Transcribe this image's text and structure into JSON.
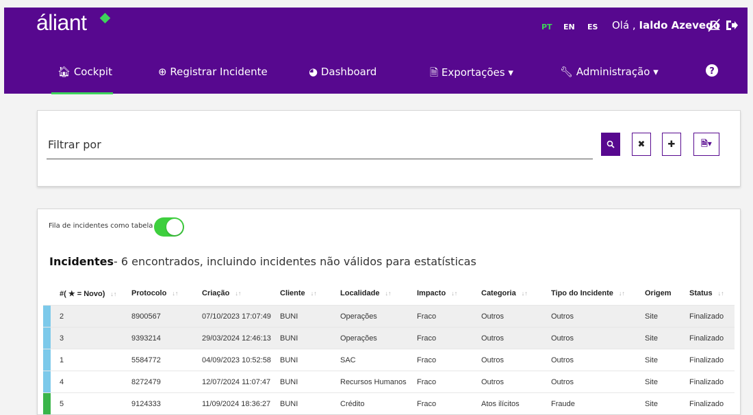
{
  "header": {
    "logo": "áliant",
    "languages": [
      {
        "code": "PT",
        "active": true
      },
      {
        "code": "EN",
        "active": false
      },
      {
        "code": "ES",
        "active": false
      }
    ],
    "greeting_prefix": "Olá ,",
    "user_name": "Ialdo Azevedo",
    "icons": [
      "notifications-off-icon",
      "logout-icon"
    ]
  },
  "nav": {
    "cockpit": "Cockpit",
    "registrar": "Registrar Incidente",
    "dashboard": "Dashboard",
    "exportacoes": "Exportações",
    "administracao": "Administração",
    "help_icon": "question-circle-icon"
  },
  "filter": {
    "label": "Filtrar por",
    "buttons": [
      "search-icon",
      "clear-icon",
      "add-icon",
      "export-file-icon"
    ]
  },
  "incidents": {
    "toggle_label": "Fila de incidentes como tabela",
    "toggle_on": true,
    "title": "Incidentes",
    "subtitle": "- 6 encontrados, incluindo incidentes não válidos para estatísticas",
    "columns": [
      "#( ★ = Novo)",
      "Protocolo",
      "Criação",
      "Cliente",
      "Localidade",
      "Impacto",
      "Categoria",
      "Tipo do Incidente",
      "Origem",
      "Status"
    ],
    "rows": [
      {
        "stripe": "#7cc9ea",
        "cells": [
          "2",
          "8900567",
          "07/10/2023 17:07:49",
          "BUNI",
          "Operações",
          "Fraco",
          "Outros",
          "Outros",
          "Site",
          "Finalizado"
        ]
      },
      {
        "stripe": "#7cc9ea",
        "cells": [
          "3",
          "9393214",
          "29/03/2024 12:46:13",
          "BUNI",
          "Operações",
          "Fraco",
          "Outros",
          "Outros",
          "Site",
          "Finalizado"
        ]
      },
      {
        "stripe": "#7cc9ea",
        "cells": [
          "1",
          "5584772",
          "04/09/2023 10:52:58",
          "BUNI",
          "SAC",
          "Fraco",
          "Outros",
          "Outros",
          "Site",
          "Finalizado"
        ]
      },
      {
        "stripe": "#7cc9ea",
        "cells": [
          "4",
          "8272479",
          "12/07/2024 11:07:47",
          "BUNI",
          "Recursos Humanos",
          "Fraco",
          "Outros",
          "Outros",
          "Site",
          "Finalizado"
        ]
      },
      {
        "stripe": "#3ab54a",
        "cells": [
          "5",
          "9124333",
          "11/09/2024 18:36:27",
          "BUNI",
          "Crédito",
          "Fraco",
          "Atos ilícitos",
          "Fraude",
          "Site",
          "Finalizado"
        ]
      }
    ]
  },
  "colors": {
    "brand": "#57088f",
    "accent": "#3ed35a"
  }
}
